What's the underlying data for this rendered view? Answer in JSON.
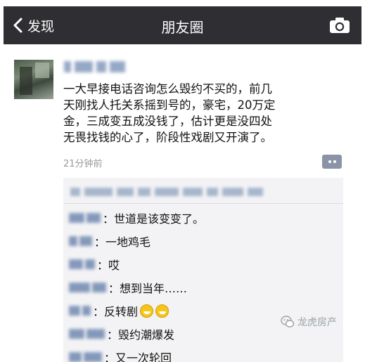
{
  "navbar": {
    "back_label": "发现",
    "title": "朋友圈"
  },
  "post": {
    "text": "一大早接电话咨询怎么毁约不买的，前几\n天刚找人托关系摇到号的，豪宅，20万定\n金，三成变五成没钱了，估计更是没四处\n无畏找钱的心了，阶段性戏剧又开演了。",
    "time": "21分钟前"
  },
  "comments": [
    {
      "text": "：世道是该变变了。",
      "emoji_count": 0
    },
    {
      "text": "：一地鸡毛",
      "emoji_count": 0
    },
    {
      "text": "：哎",
      "emoji_count": 0
    },
    {
      "text": "：想到当年……",
      "emoji_count": 0
    },
    {
      "text": "：反转剧",
      "emoji_count": 2
    },
    {
      "text": "：毁约潮爆发",
      "emoji_count": 0
    },
    {
      "text": "：又一次轮回",
      "emoji_count": 0
    }
  ],
  "watermark": {
    "text": "龙虎房产"
  },
  "colors": {
    "navbar_bg": "#2f2f33",
    "comments_bg": "#f3f3f5",
    "name_blur": "#7f94b8"
  },
  "icons": [
    "chevron-left-icon",
    "camera-icon",
    "comment-dots-icon",
    "grin-emoji-icon",
    "wechat-logo-icon"
  ]
}
